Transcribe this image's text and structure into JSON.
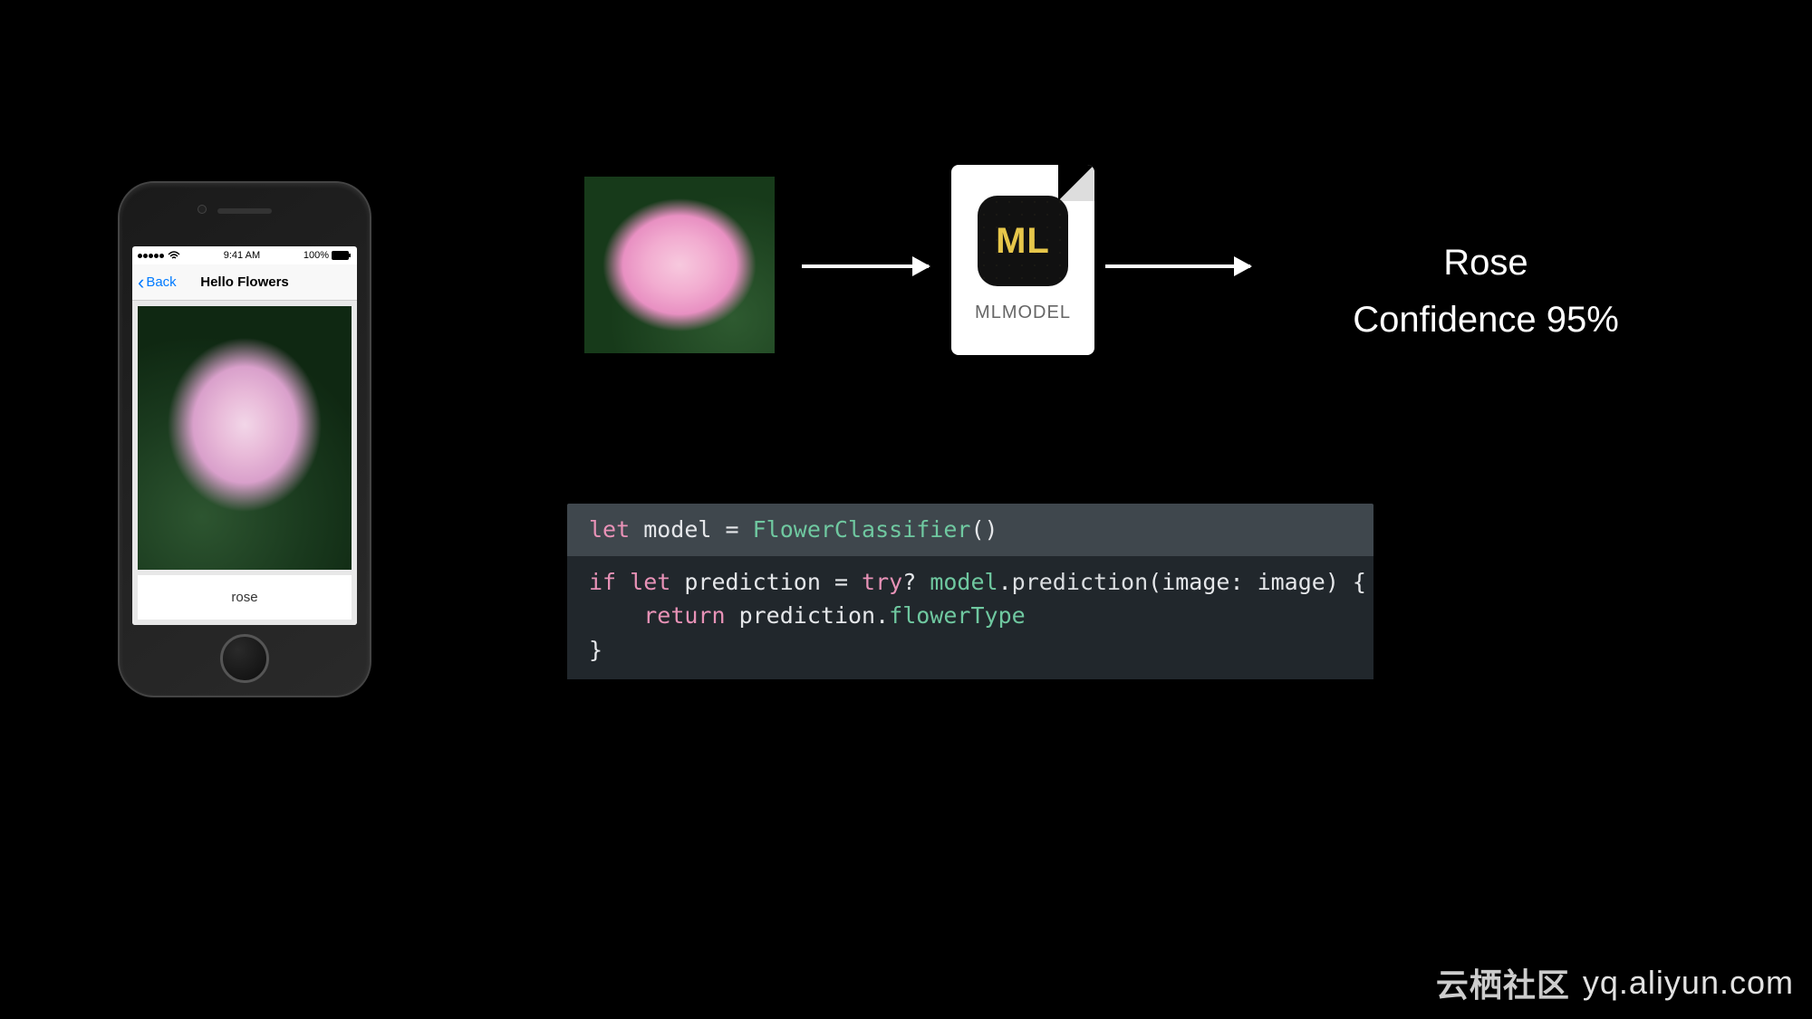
{
  "phone": {
    "status": {
      "carrier": "",
      "time": "9:41 AM",
      "battery": "100%"
    },
    "back_label": "Back",
    "title": "Hello Flowers",
    "result_label": "rose"
  },
  "file": {
    "badge_text": "ML",
    "type_label": "MLMODEL"
  },
  "output": {
    "class_label": "Rose",
    "confidence_label": "Confidence 95%"
  },
  "code": {
    "line1": {
      "kw_let": "let",
      "var": " model = ",
      "cls": "FlowerClassifier",
      "tail": "()"
    },
    "body": {
      "kw_if": "if",
      "sp1": " ",
      "kw_let": "let",
      "mid1": " prediction = ",
      "kw_try": "try",
      "mid2": "? ",
      "id_model": "model",
      "mid3": ".",
      "fn_pred": "prediction",
      "mid4": "(image: image) {",
      "indent": "    ",
      "kw_return": "return",
      "mid5": " prediction.",
      "id_flower": "flowerType",
      "close": "}"
    }
  },
  "watermark": {
    "cn": "云栖社区",
    "en": "yq.aliyun.com"
  }
}
